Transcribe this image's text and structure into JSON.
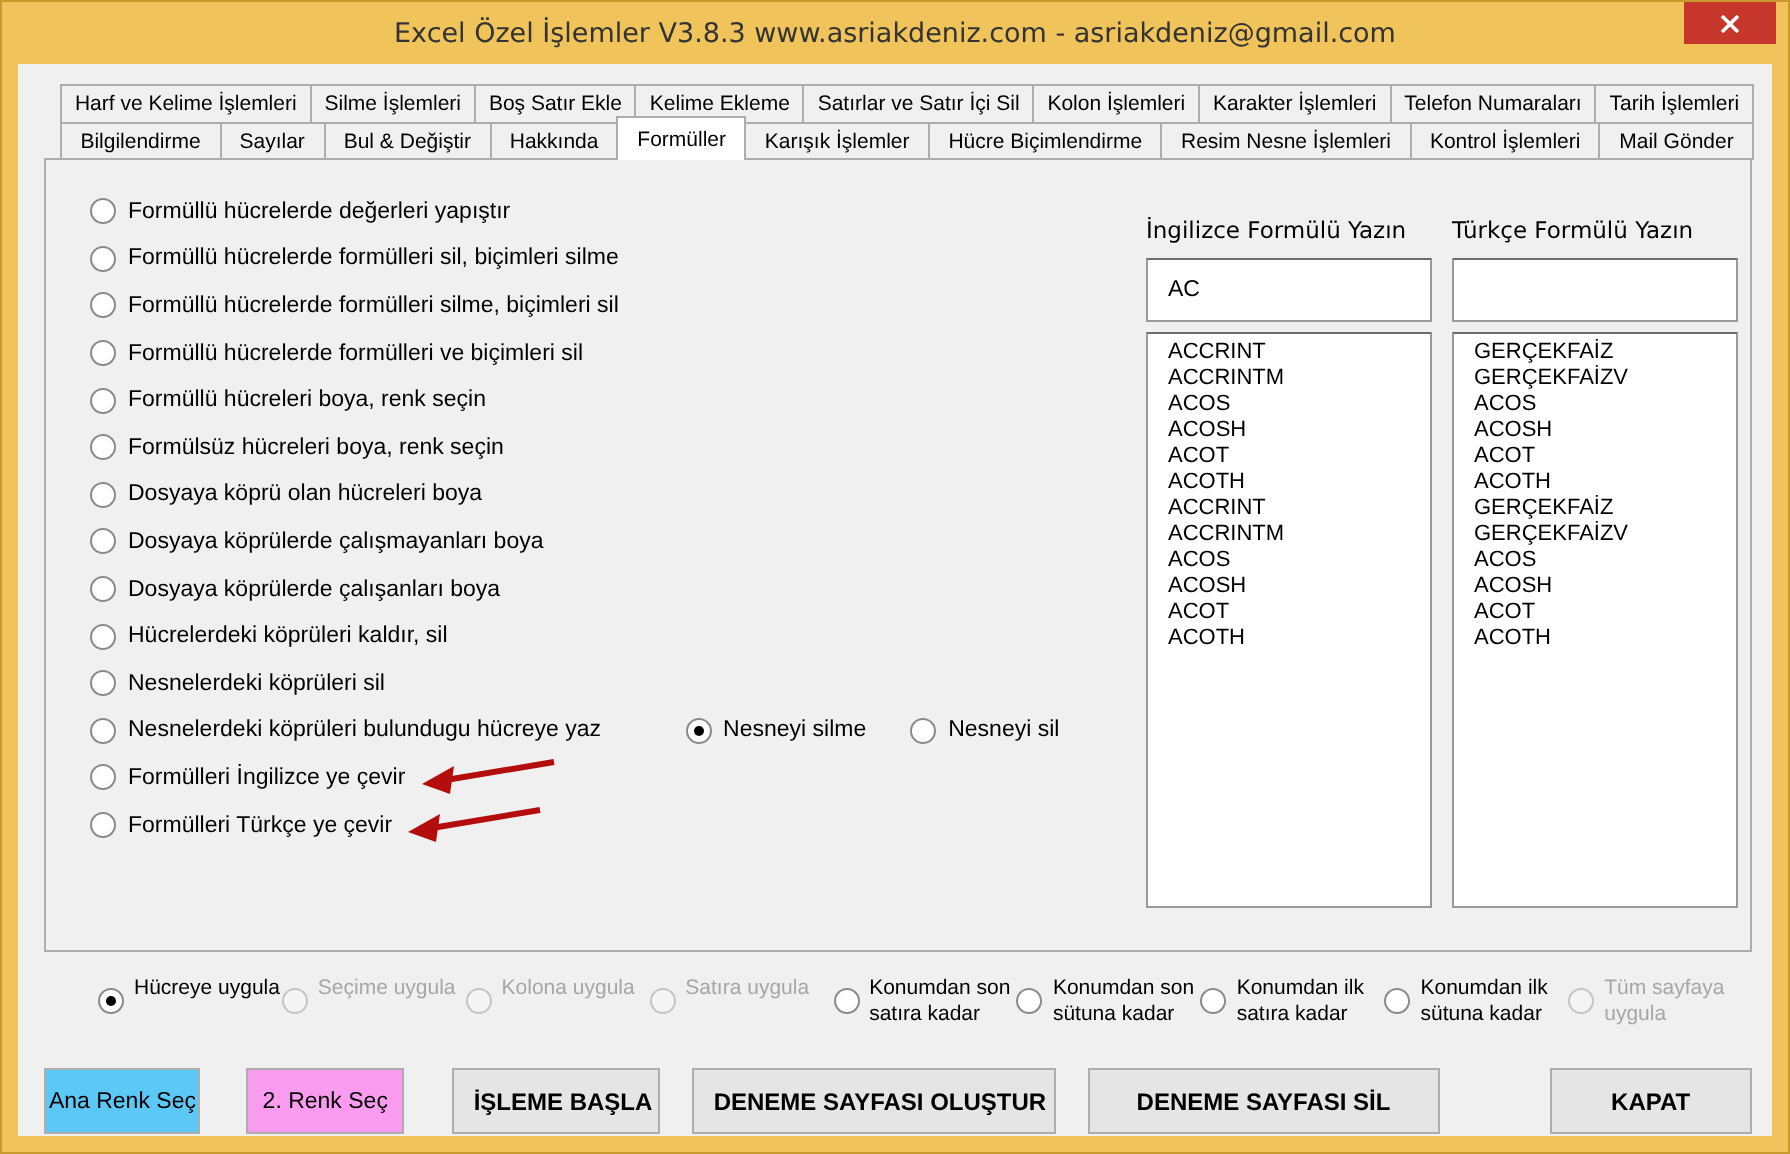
{
  "window": {
    "title": "Excel Özel İşlemler V3.8.3  www.asriakdeniz.com -  asriakdeniz@gmail.com"
  },
  "tab_rows": [
    [
      {
        "label": "Harf ve Kelime İşlemleri",
        "selected": false
      },
      {
        "label": "Silme İşlemleri",
        "selected": false
      },
      {
        "label": "Boş Satır Ekle",
        "selected": false
      },
      {
        "label": "Kelime Ekleme",
        "selected": false
      },
      {
        "label": "Satırlar ve Satır İçi Sil",
        "selected": false
      },
      {
        "label": "Kolon İşlemleri",
        "selected": false
      },
      {
        "label": "Karakter İşlemleri",
        "selected": false
      },
      {
        "label": "Telefon Numaraları",
        "selected": false
      },
      {
        "label": "Tarih İşlemleri",
        "selected": false
      }
    ],
    [
      {
        "label": "Bilgilendirme",
        "selected": false
      },
      {
        "label": "Sayılar",
        "selected": false
      },
      {
        "label": "Bul & Değiştir",
        "selected": false
      },
      {
        "label": "Hakkında",
        "selected": false
      },
      {
        "label": "Formüller",
        "selected": true
      },
      {
        "label": "Karışık İşlemler",
        "selected": false
      },
      {
        "label": "Hücre Biçimlendirme",
        "selected": false
      },
      {
        "label": "Resim Nesne İşlemleri",
        "selected": false
      },
      {
        "label": "Kontrol İşlemleri",
        "selected": false
      },
      {
        "label": "Mail Gönder",
        "selected": false
      }
    ]
  ],
  "options": [
    {
      "label": "Formüllü hücrelerde değerleri yapıştır",
      "selected": false,
      "arrow": false
    },
    {
      "label": "Formüllü hücrelerde formülleri sil, biçimleri silme",
      "selected": false,
      "arrow": false
    },
    {
      "label": "Formüllü hücrelerde formülleri silme, biçimleri sil",
      "selected": false,
      "arrow": false
    },
    {
      "label": "Formüllü hücrelerde formülleri ve biçimleri sil",
      "selected": false,
      "arrow": false
    },
    {
      "label": "Formüllü hücreleri boya, renk seçin",
      "selected": false,
      "arrow": false
    },
    {
      "label": "Formülsüz hücreleri boya, renk seçin",
      "selected": false,
      "arrow": false
    },
    {
      "label": "Dosyaya köprü olan hücreleri boya",
      "selected": false,
      "arrow": false
    },
    {
      "label": "Dosyaya köprülerde çalışmayanları boya",
      "selected": false,
      "arrow": false
    },
    {
      "label": "Dosyaya köprülerde çalışanları boya",
      "selected": false,
      "arrow": false
    },
    {
      "label": "Hücrelerdeki köprüleri kaldır, sil",
      "selected": false,
      "arrow": false
    },
    {
      "label": "Nesnelerdeki köprüleri sil",
      "selected": false,
      "arrow": false
    },
    {
      "label": "Nesnelerdeki köprüleri bulundugu hücreye yaz",
      "selected": false,
      "arrow": false,
      "sub_options": [
        {
          "label": "Nesneyi silme",
          "selected": true
        },
        {
          "label": "Nesneyi sil",
          "selected": false
        }
      ]
    },
    {
      "label": "Formülleri İngilizce ye çevir",
      "selected": false,
      "arrow": true
    },
    {
      "label": "Formülleri Türkçe ye çevir",
      "selected": false,
      "arrow": true
    }
  ],
  "formula_columns": [
    {
      "heading": "İngilizce Formülü Yazın",
      "input": "AC",
      "items": [
        "ACCRINT",
        "ACCRINTM",
        "ACOS",
        "ACOSH",
        "ACOT",
        "ACOTH",
        "ACCRINT",
        "ACCRINTM",
        "ACOS",
        "ACOSH",
        "ACOT",
        "ACOTH"
      ]
    },
    {
      "heading": "Türkçe Formülü Yazın",
      "items": [
        "GERÇEKFAİZ",
        "GERÇEKFAİZV",
        "ACOS",
        "ACOSH",
        "ACOT",
        "ACOTH",
        "GERÇEKFAİZ",
        "GERÇEKFAİZV",
        "ACOS",
        "ACOSH",
        "ACOT",
        "ACOTH"
      ]
    }
  ],
  "scope_options": [
    {
      "label": "Hücreye uygula",
      "selected": true,
      "disabled": false
    },
    {
      "label": "Seçime uygula",
      "selected": false,
      "disabled": true
    },
    {
      "label": "Kolona uygula",
      "selected": false,
      "disabled": true
    },
    {
      "label": "Satıra uygula",
      "selected": false,
      "disabled": true
    },
    {
      "label": "Konumdan son satıra kadar",
      "selected": false,
      "disabled": false
    },
    {
      "label": "Konumdan son sütuna kadar",
      "selected": false,
      "disabled": false
    },
    {
      "label": "Konumdan ilk satıra kadar",
      "selected": false,
      "disabled": false
    },
    {
      "label": "Konumdan ilk sütuna kadar",
      "selected": false,
      "disabled": false
    },
    {
      "label": "Tüm sayfaya uygula",
      "selected": false,
      "disabled": true
    }
  ],
  "buttons": [
    {
      "label": "Ana Renk Seç",
      "kind": "color",
      "color": "#5bc8f5"
    },
    {
      "label": "2. Renk Seç",
      "kind": "color",
      "color": "#f99cf0"
    },
    {
      "label": "İŞLEME BAŞLA",
      "kind": "action"
    },
    {
      "label": "DENEME SAYFASI OLUŞTUR",
      "kind": "action"
    },
    {
      "label": "DENEME SAYFASI SİL",
      "kind": "action"
    },
    {
      "label": "KAPAT",
      "kind": "action"
    }
  ]
}
